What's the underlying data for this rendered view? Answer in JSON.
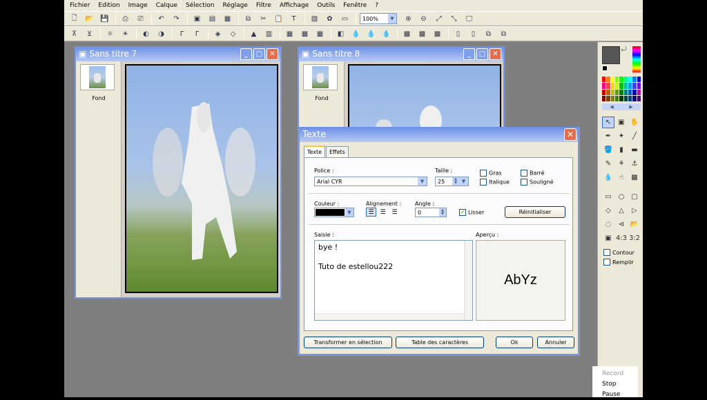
{
  "menu": [
    "Fichier",
    "Edition",
    "Image",
    "Calque",
    "Sélection",
    "Réglage",
    "Filtre",
    "Affichage",
    "Outils",
    "Fenêtre",
    "?"
  ],
  "toolbar": {
    "zoom": "100%"
  },
  "windows": [
    {
      "title": "Sans titre 7",
      "layer_name": "Fond"
    },
    {
      "title": "Sans titre 8",
      "layer_name": "Fond"
    }
  ],
  "panel": {
    "options": [
      {
        "label": "Contour",
        "checked": false
      },
      {
        "label": "Remplir",
        "checked": false
      }
    ]
  },
  "dialog": {
    "title": "Texte",
    "tabs": [
      "Texte",
      "Effets"
    ],
    "police_label": "Police :",
    "police_value": "Arial CYR",
    "taille_label": "Taille :",
    "taille_value": "25",
    "styles": [
      {
        "label": "Gras",
        "checked": false
      },
      {
        "label": "Barré",
        "checked": false
      },
      {
        "label": "Italique",
        "checked": false
      },
      {
        "label": "Souligné",
        "checked": false
      }
    ],
    "couleur_label": "Couleur :",
    "couleur_value": "#000000",
    "alignement_label": "Alignement :",
    "angle_label": "Angle :",
    "angle_value": "0",
    "lisser_label": "Lisser",
    "lisser_checked": true,
    "reset_label": "Réinitialiser",
    "saisie_label": "Saisie :",
    "saisie_lines": [
      "bye !",
      "",
      "Tuto de estellou222"
    ],
    "apercu_label": "Aperçu :",
    "apercu_text": "AbYz",
    "buttons": {
      "transform": "Transformer en sélection",
      "charmap": "Table des caractères",
      "ok": "Ok",
      "cancel": "Annuler"
    }
  },
  "recorder": [
    "Record",
    "Stop",
    "Pause"
  ]
}
